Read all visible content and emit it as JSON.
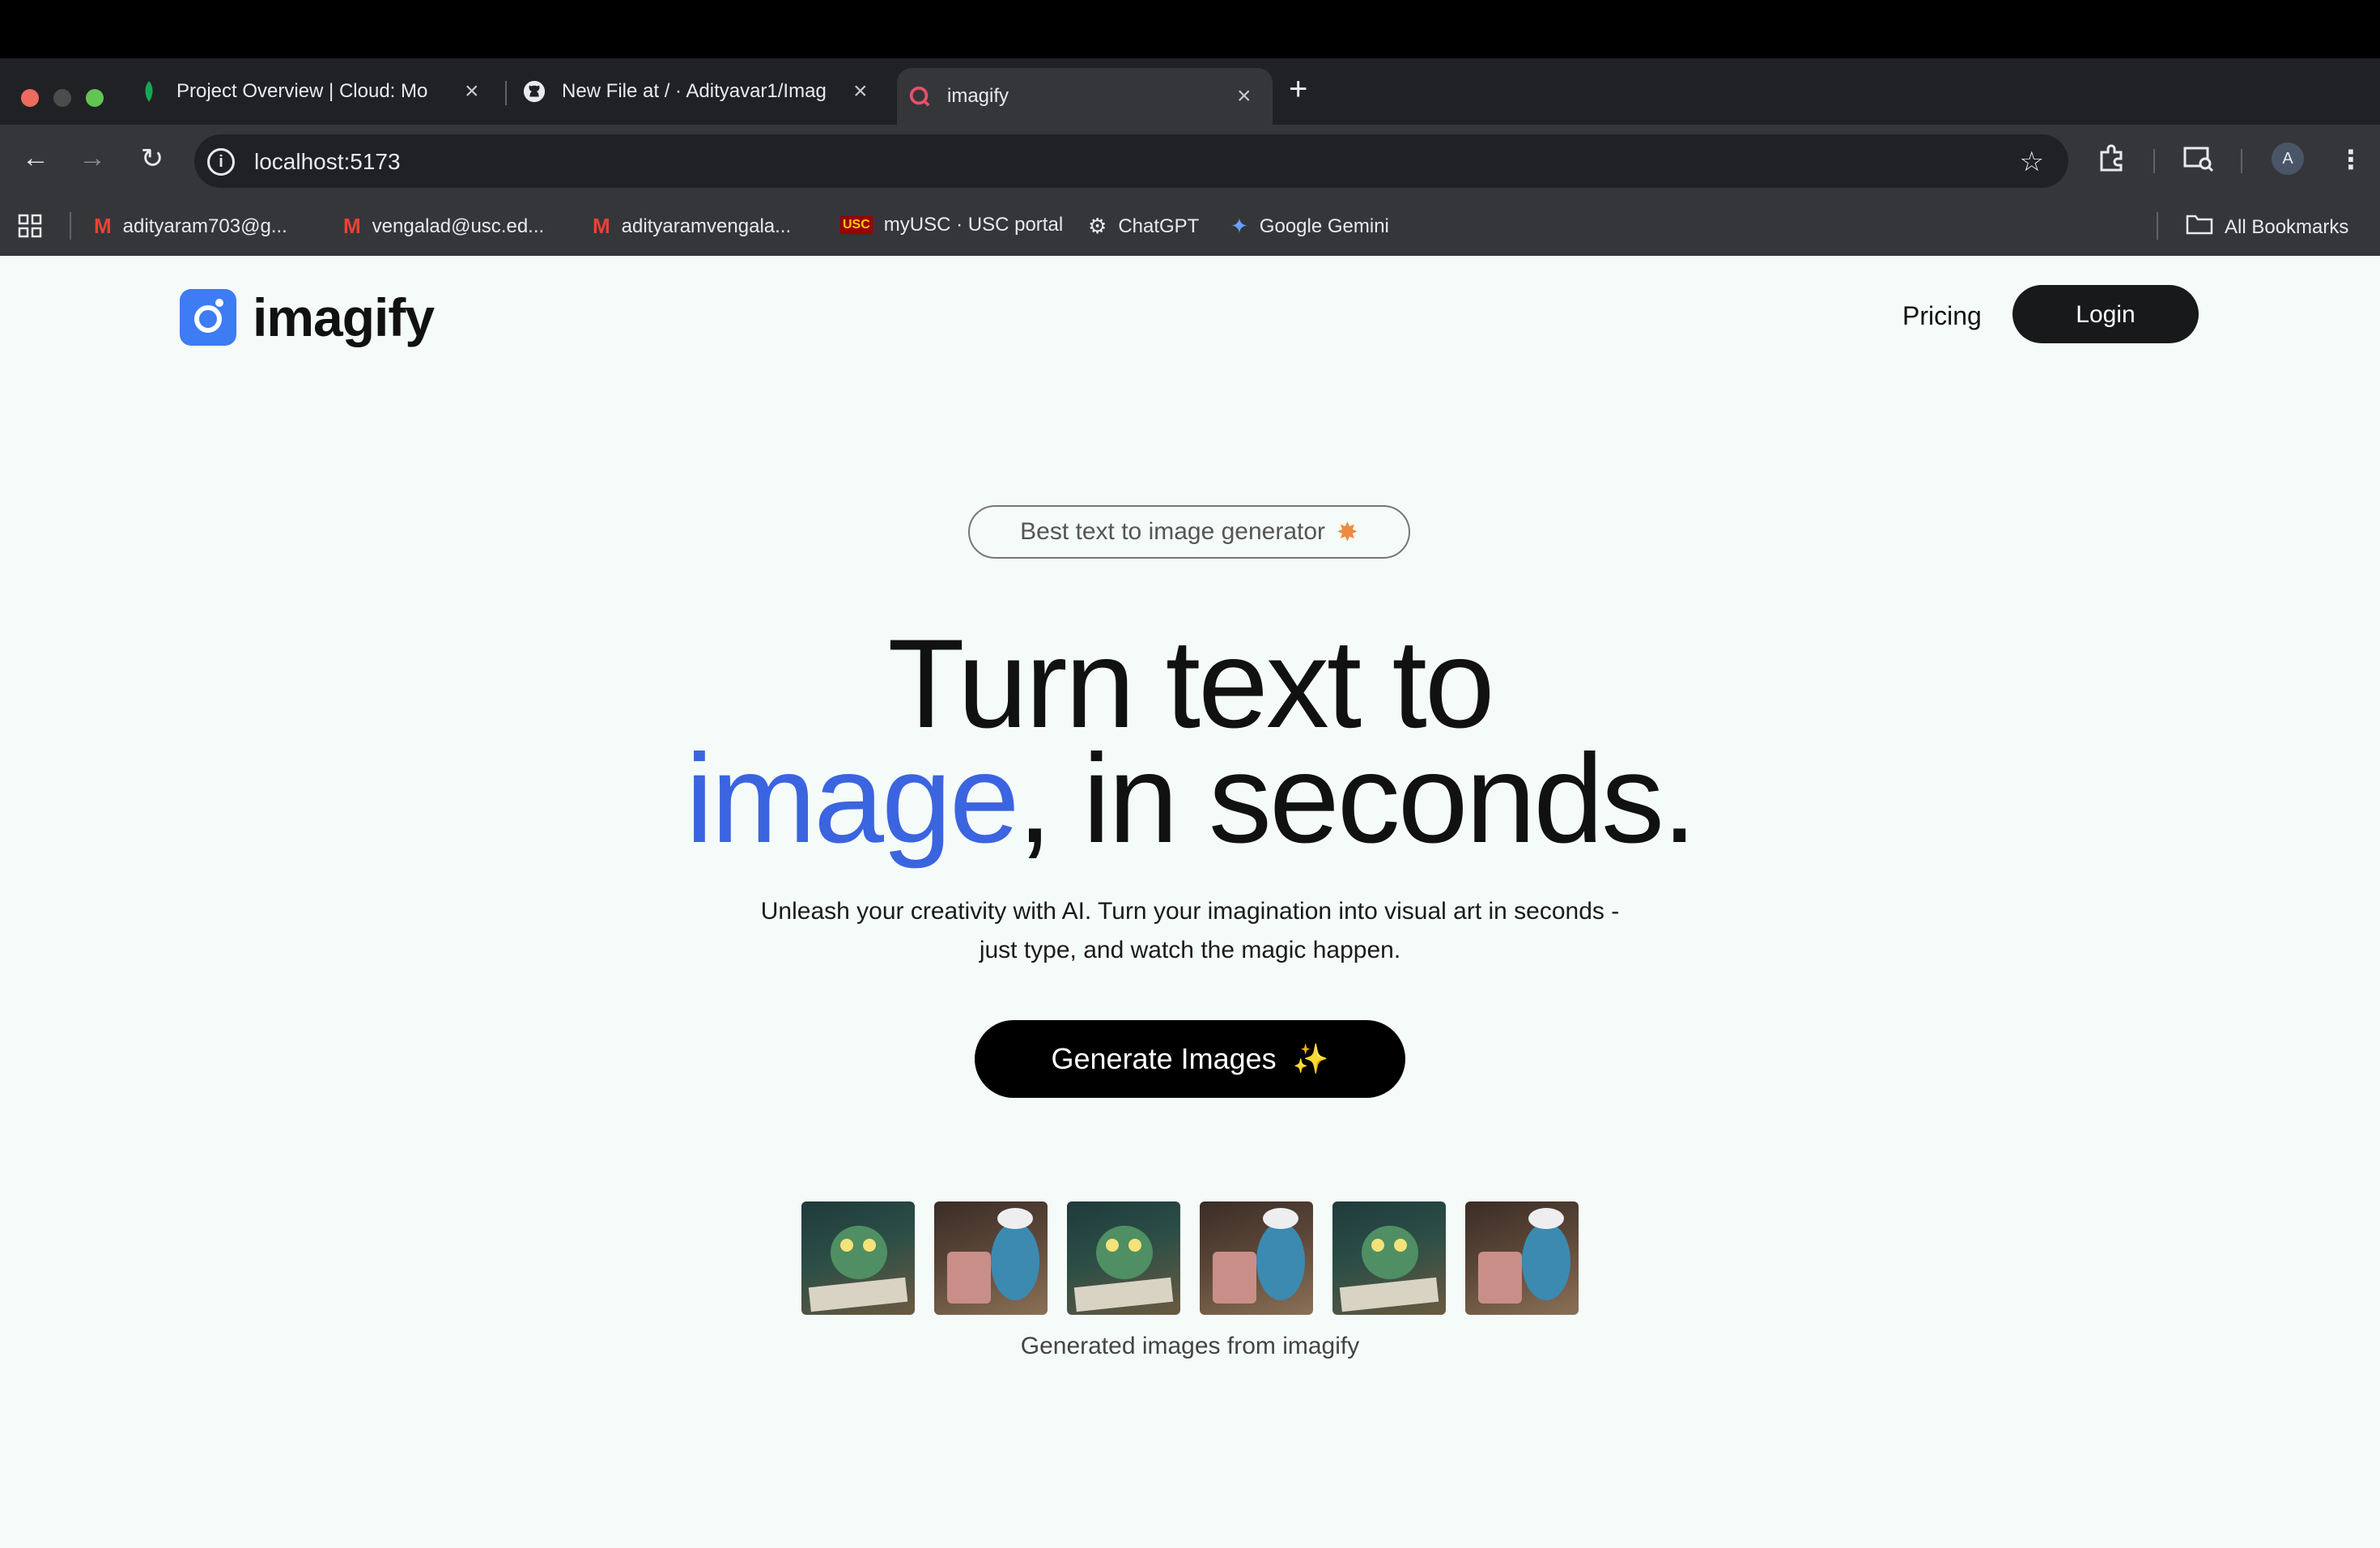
{
  "browser": {
    "tabs": [
      {
        "title": "Project Overview | Cloud: Mo",
        "favicon": "mongodb-leaf-icon",
        "active": false
      },
      {
        "title": "New File at / · Adityavar1/Imag",
        "favicon": "github-icon",
        "active": false
      },
      {
        "title": "imagify",
        "favicon": "imagify-q-icon",
        "active": true
      }
    ],
    "url": "localhost:5173",
    "profile_initial": "A",
    "bookmarks": [
      {
        "label": "adityaram703@g...",
        "icon": "gmail-icon"
      },
      {
        "label": "vengalad@usc.ed...",
        "icon": "gmail-icon"
      },
      {
        "label": "adityaramvengala...",
        "icon": "gmail-icon"
      },
      {
        "label": "myUSC · USC portal",
        "icon": "usc-icon"
      },
      {
        "label": "ChatGPT",
        "icon": "chatgpt-icon"
      },
      {
        "label": "Google Gemini",
        "icon": "gemini-icon"
      }
    ],
    "all_bookmarks": "All Bookmarks"
  },
  "nav": {
    "brand": "imagify",
    "pricing": "Pricing",
    "login": "Login"
  },
  "hero": {
    "badge": "Best text to image generator",
    "title_line1": "Turn text to",
    "title_accent": "image",
    "title_line2_rest": ", in seconds.",
    "subtitle_line1": "Unleash your creativity with AI. Turn your imagination into visual art in seconds -",
    "subtitle_line2": "just type, and watch the magic happen.",
    "cta": "Generate Images",
    "caption": "Generated images from imagify"
  },
  "colors": {
    "accent": "#3b64e0",
    "logo_blue": "#3d7cf2",
    "page_bg": "#f5fbf8",
    "dark_button": "#18191b"
  }
}
